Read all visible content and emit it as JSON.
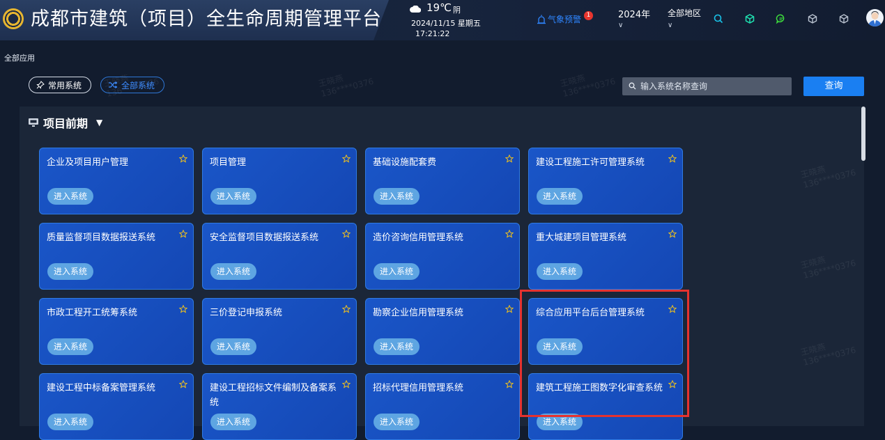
{
  "header": {
    "title": "成都市建筑（项目）全生命周期管理平台",
    "weather": {
      "temp": "19℃",
      "condition": "阴",
      "date": "2024/11/15  星期五",
      "time": "17:21:22"
    },
    "warning_label": "气象预警",
    "warning_count": "1",
    "year": "2024年",
    "region": "全部地区"
  },
  "breadcrumb": "全部应用",
  "filters": {
    "common": "常用系统",
    "all": "全部系统"
  },
  "search": {
    "placeholder": "输入系统名称查询",
    "button": "查询"
  },
  "section": {
    "title": "项目前期"
  },
  "enter_label": "进入系统",
  "cards": [
    "企业及项目用户管理",
    "项目管理",
    "基础设施配套费",
    "建设工程施工许可管理系统",
    "质量监督项目数据报送系统",
    "安全监督项目数据报送系统",
    "造价咨询信用管理系统",
    "重大城建项目管理系统",
    "市政工程开工统筹系统",
    "三价登记申报系统",
    "勘察企业信用管理系统",
    "综合应用平台后台管理系统",
    "建设工程中标备案管理系统",
    "建设工程招标文件编制及备案系统",
    "招标代理信用管理系统",
    "建筑工程施工图数字化审查系统"
  ],
  "watermark": {
    "name": "王晓燕",
    "phone": "136****0376"
  },
  "colors": {
    "accent": "#1a7ff2",
    "card": "#1a56c8",
    "highlight": "#e5322f",
    "warning": "#2f86ff"
  }
}
